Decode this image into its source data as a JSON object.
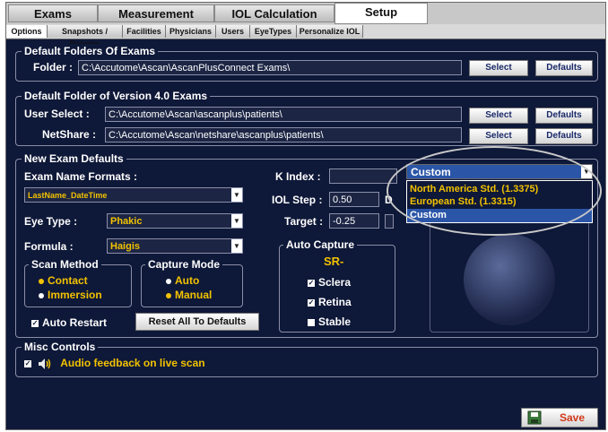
{
  "main_tabs": [
    "Exams",
    "Measurement",
    "IOL Calculation",
    "Setup"
  ],
  "sub_tabs": [
    "Options",
    "Snapshots / Reports",
    "Facilities",
    "Physicians",
    "Users",
    "EyeTypes",
    "Personalize IOL"
  ],
  "default_folders": {
    "legend": "Default Folders Of Exams",
    "folder_label": "Folder :",
    "folder_value": "C:\\Accutome\\Ascan\\AscanPlusConnect Exams\\",
    "select": "Select",
    "defaults": "Defaults"
  },
  "v4_folder": {
    "legend": "Default Folder of Version 4.0 Exams",
    "user_select_label": "User Select :",
    "user_select_value": "C:\\Accutome\\Ascan\\ascanplus\\patients\\",
    "netshare_label": "NetShare :",
    "netshare_value": "C:\\Accutome\\Ascan\\netshare\\ascanplus\\patients\\",
    "select": "Select",
    "defaults": "Defaults"
  },
  "new_exam": {
    "legend": "New Exam Defaults",
    "name_formats_label": "Exam Name Formats :",
    "name_format_value": "LastName_DateTime",
    "eye_type_label": "Eye Type :",
    "eye_type_value": "Phakic",
    "formula_label": "Formula :",
    "formula_value": "Haigis",
    "k_index_label": "K Index :",
    "iol_step_label": "IOL Step :",
    "iol_step_value": "0.50",
    "iol_step_unit": "D",
    "target_label": "Target :",
    "target_value": "-0.25",
    "k_index_dropdown_value": "Custom",
    "k_index_options": [
      "North America Std. (1.3375)",
      "European Std. (1.3315)",
      "Custom"
    ],
    "scan_method": {
      "legend": "Scan Method",
      "options": [
        "Contact",
        "Immersion"
      ],
      "selected": "Contact"
    },
    "capture_mode": {
      "legend": "Capture Mode",
      "options": [
        "Auto",
        "Manual"
      ],
      "selected": "Manual"
    },
    "auto_capture": {
      "legend": "Auto Capture",
      "mode": "SR-",
      "options": [
        "Sclera",
        "Retina",
        "Stable"
      ]
    },
    "auto_restart": "Auto Restart",
    "reset_all": "Reset All To Defaults"
  },
  "misc": {
    "legend": "Misc Controls",
    "audio_feedback": "Audio feedback on live scan"
  },
  "save": "Save",
  "colors": {
    "background": "#0e1838",
    "accent": "#f2c200",
    "text": "#ffffff",
    "highlight": "#2b56a8"
  },
  "icons": [
    "speaker-icon",
    "save-disk-icon",
    "dropdown-arrow-icon"
  ]
}
